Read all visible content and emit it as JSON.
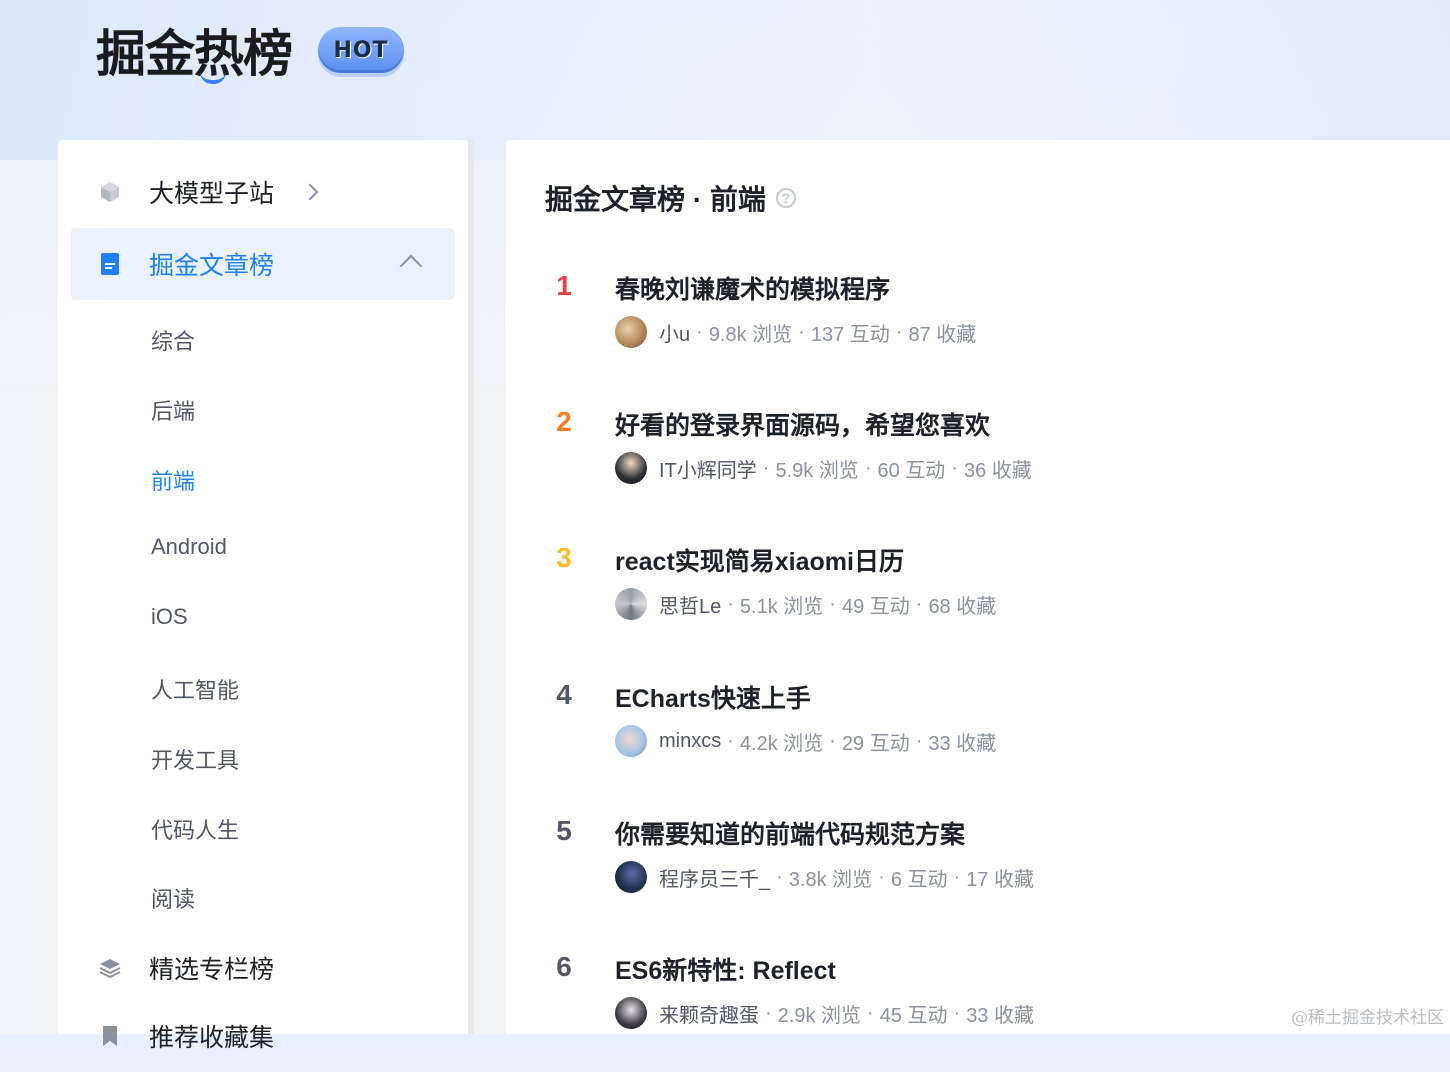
{
  "header": {
    "logo_text": "掘金热榜",
    "hot_badge": "HOT"
  },
  "sidebar": {
    "items": [
      {
        "label": "大模型子站",
        "icon": "cube-icon"
      },
      {
        "label": "掘金文章榜",
        "icon": "document-icon",
        "active": true
      },
      {
        "label": "精选专栏榜",
        "icon": "layers-icon"
      },
      {
        "label": "推荐收藏集",
        "icon": "bookmark-icon"
      }
    ],
    "sub_items": [
      "综合",
      "后端",
      "前端",
      "Android",
      "iOS",
      "人工智能",
      "开发工具",
      "代码人生",
      "阅读"
    ],
    "active_sub": "前端"
  },
  "main": {
    "title": "掘金文章榜 · 前端",
    "help_icon": "?",
    "articles": [
      {
        "rank": "1",
        "title": "春晚刘谦魔术的模拟程序",
        "author": "小u",
        "views": "9.8k 浏览",
        "interactions": "137 互动",
        "favorites": "87 收藏"
      },
      {
        "rank": "2",
        "title": "好看的登录界面源码，希望您喜欢",
        "author": "IT小辉同学",
        "views": "5.9k 浏览",
        "interactions": "60 互动",
        "favorites": "36 收藏"
      },
      {
        "rank": "3",
        "title": "react实现简易xiaomi日历",
        "author": "思哲Le",
        "views": "5.1k 浏览",
        "interactions": "49 互动",
        "favorites": "68 收藏"
      },
      {
        "rank": "4",
        "title": "ECharts快速上手",
        "author": "minxcs",
        "views": "4.2k 浏览",
        "interactions": "29 互动",
        "favorites": "33 收藏"
      },
      {
        "rank": "5",
        "title": "你需要知道的前端代码规范方案",
        "author": "程序员三千_",
        "views": "3.8k 浏览",
        "interactions": "6 互动",
        "favorites": "17 收藏"
      },
      {
        "rank": "6",
        "title": "ES6新特性: Reflect",
        "author": "来颗奇趣蛋",
        "views": "2.9k 浏览",
        "interactions": "45 互动",
        "favorites": "33 收藏"
      }
    ]
  },
  "watermark": "@稀土掘金技术社区",
  "colors": {
    "accent": "#1e80ff",
    "rank1": "#f04142",
    "rank2": "#fc7a22",
    "rank3": "#fdbb2a",
    "rank_default": "#515767"
  }
}
